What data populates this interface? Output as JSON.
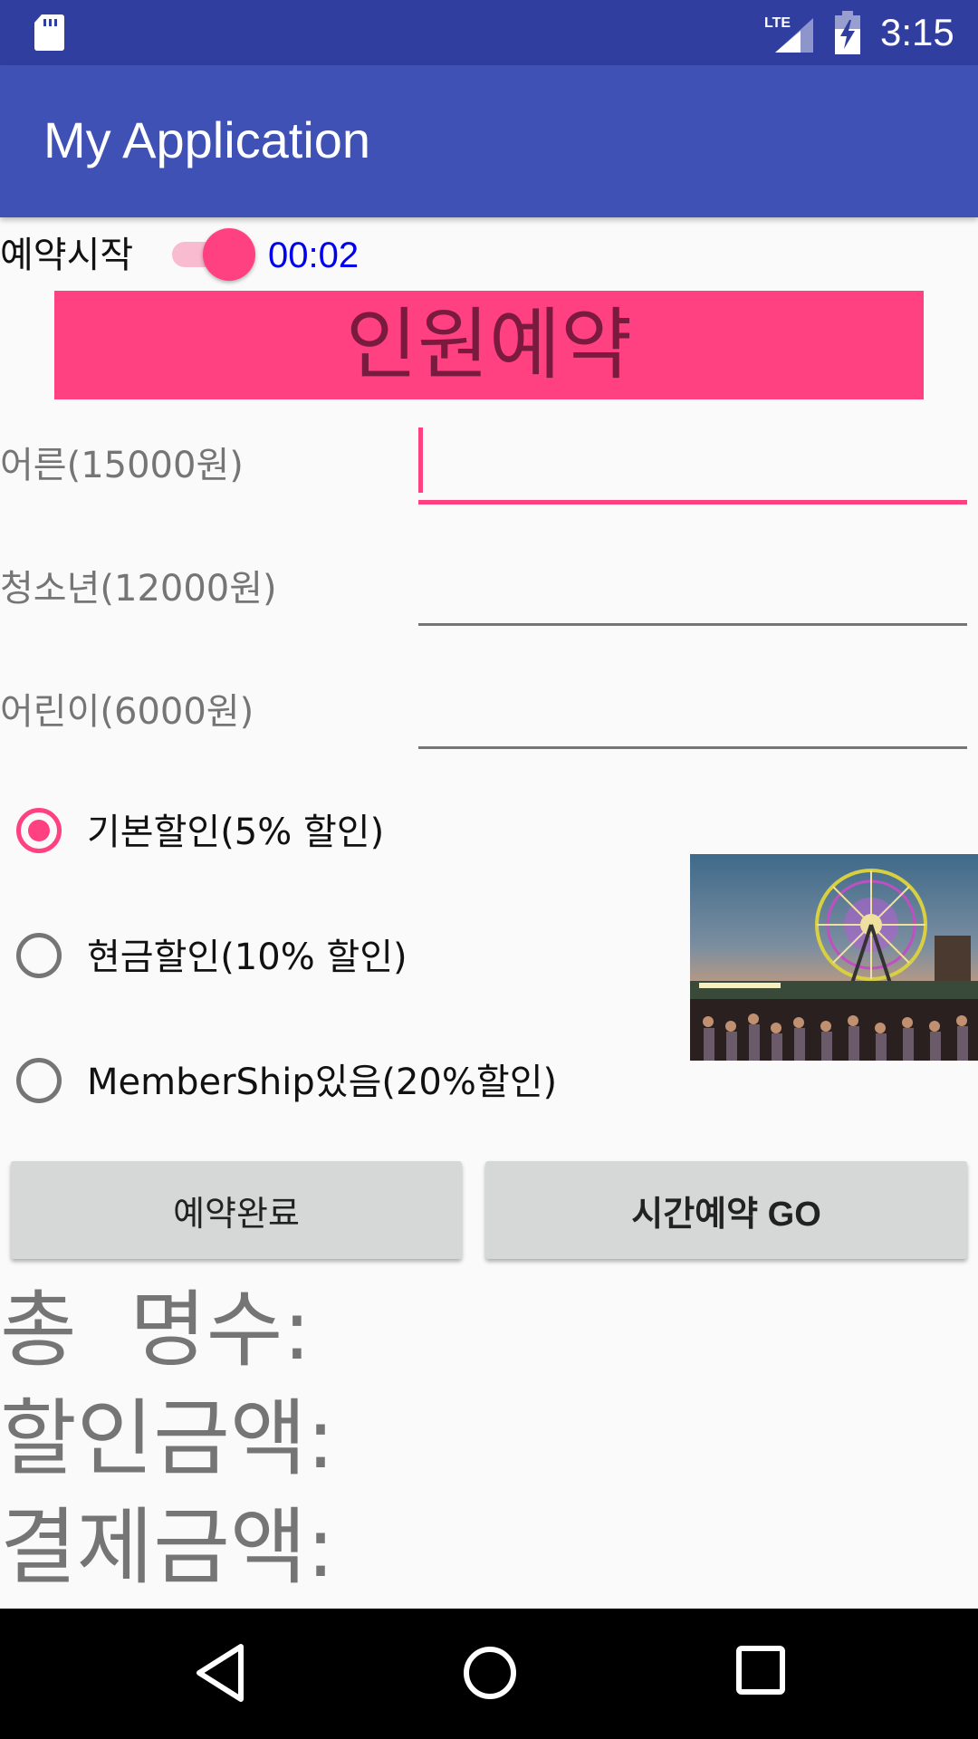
{
  "status_bar": {
    "time": "3:15",
    "icons": [
      "sd-card-icon",
      "lte-signal-icon",
      "battery-charging-icon"
    ],
    "network_label": "LTE"
  },
  "app_bar": {
    "title": "My Application",
    "color": "#3f51b5"
  },
  "reservation": {
    "start_label": "예약시작",
    "switch_on": true,
    "timer": "00:02"
  },
  "banner": {
    "title": "인원예약",
    "color": "#ff4081"
  },
  "fields": [
    {
      "label": "어른(15000원)",
      "value": "",
      "focused": true
    },
    {
      "label": "청소년(12000원)",
      "value": "",
      "focused": false
    },
    {
      "label": "어린이(6000원)",
      "value": "",
      "focused": false
    }
  ],
  "discounts": [
    {
      "label": "기본할인(5% 할인)",
      "checked": true
    },
    {
      "label": "현금할인(10% 할인)",
      "checked": false
    },
    {
      "label": "MemberShip있음(20%할인)",
      "checked": false
    }
  ],
  "photo": {
    "subject": "ferris-wheel-amusement-park"
  },
  "buttons": {
    "complete": "예약완료",
    "time_reserve": "시간예약 GO"
  },
  "summary": {
    "total_people": "총  명수:",
    "discount_amount": "할인금액:",
    "payment_amount": "결제금액:"
  },
  "nav_bar": {
    "icons": [
      "back-icon",
      "home-icon",
      "recents-icon"
    ]
  },
  "colors": {
    "accent": "#ff4081",
    "primary_dark": "#303f9f",
    "timer_text": "#0000ee"
  }
}
